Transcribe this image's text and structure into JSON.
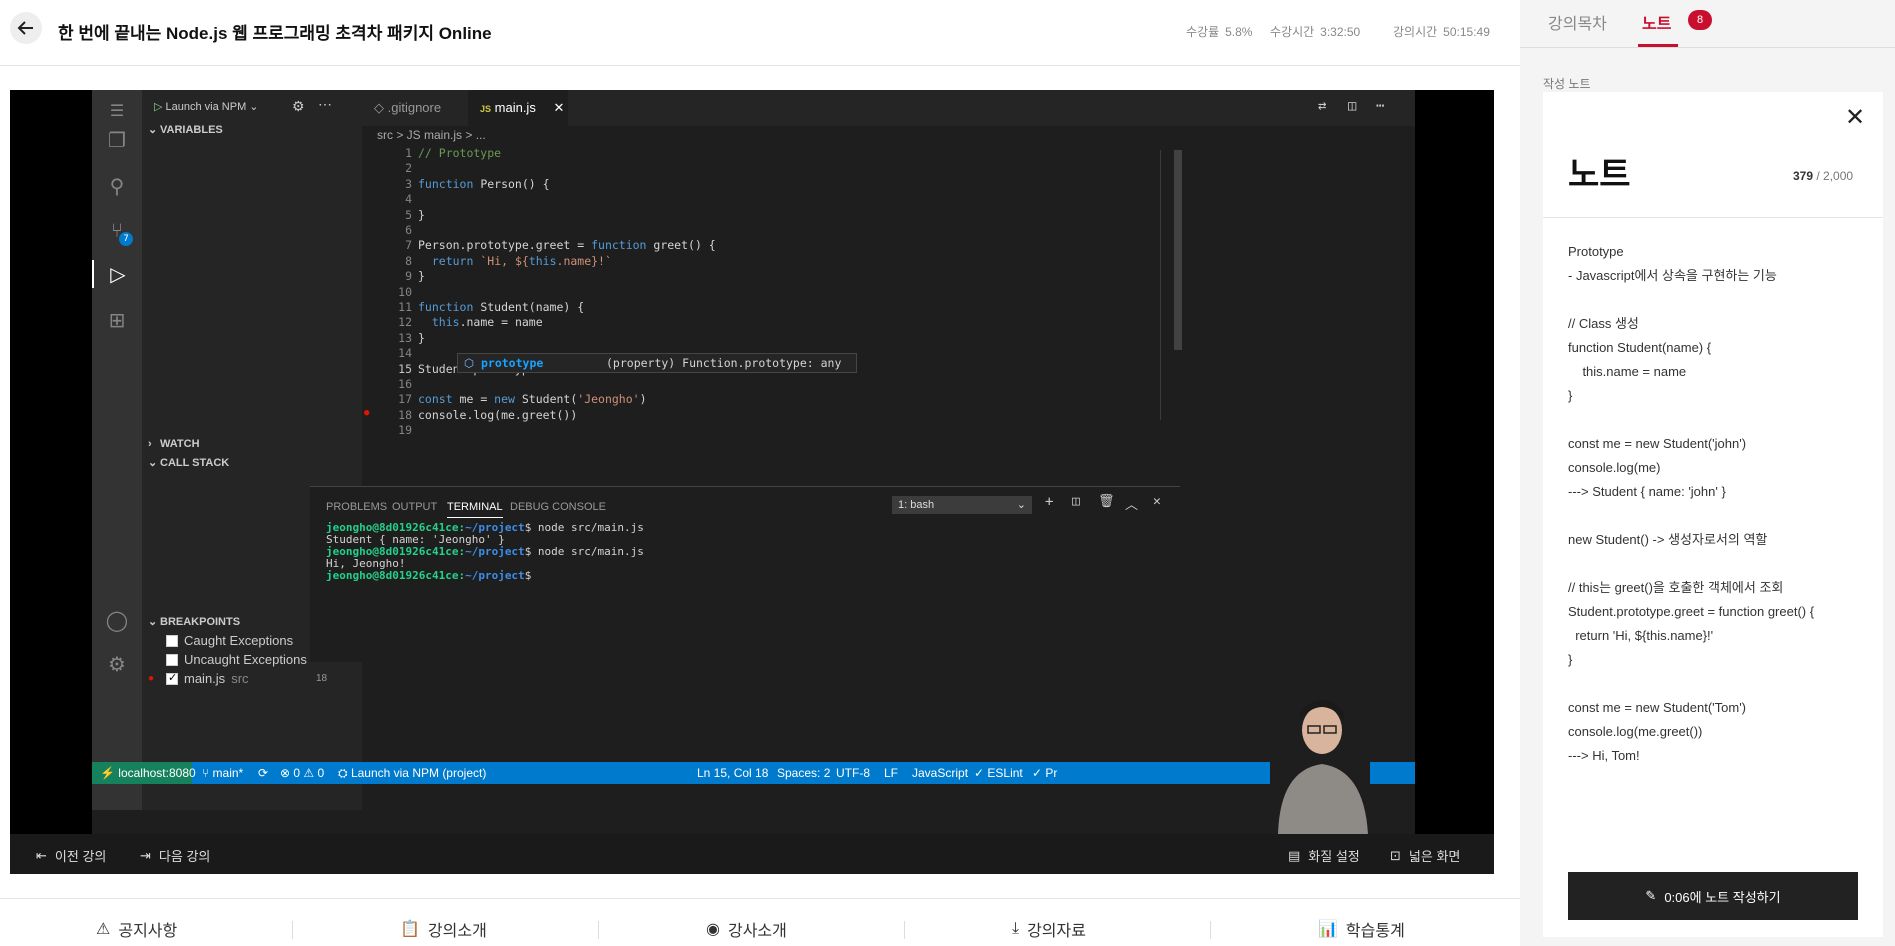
{
  "header": {
    "title": "한 번에 끝내는 Node.js 웹 프로그래밍 초격차 패키지 Online",
    "stats": [
      {
        "label": "수강률",
        "value": "5.8%"
      },
      {
        "label": "수강시간",
        "value": "3:32:50"
      },
      {
        "label": "강의시간",
        "value": "50:15:49"
      }
    ]
  },
  "vscode": {
    "debug_config": "Launch via NPM",
    "tabs": [
      ".gitignore",
      "main.js"
    ],
    "breadcrumb": "src  >  JS main.js  >  ...",
    "sections": {
      "variables": "VARIABLES",
      "watch": "WATCH",
      "call_stack": "CALL STACK",
      "breakpoints": "BREAKPOINTS"
    },
    "breakpoints": [
      {
        "label": "Caught Exceptions",
        "checked": false
      },
      {
        "label": "Uncaught Exceptions",
        "checked": false
      },
      {
        "label": "main.js",
        "sub": "src",
        "count": "18",
        "checked": true
      }
    ],
    "scm_badge": "7",
    "suggestion": {
      "name": "prototype",
      "detail": "(property) Function.prototype: any"
    },
    "panel_tabs": [
      "PROBLEMS",
      "OUTPUT",
      "TERMINAL",
      "DEBUG CONSOLE"
    ],
    "terminal_select": "1: bash",
    "terminal": [
      {
        "user": "jeongho@8d01926c41ce",
        "path": "~/project",
        "cmd": "$ node src/main.js"
      },
      {
        "text": "Student { name: 'Jeongho' }"
      },
      {
        "user": "jeongho@8d01926c41ce",
        "path": "~/project",
        "cmd": "$ node src/main.js"
      },
      {
        "text": "Hi, Jeongho!"
      },
      {
        "user": "jeongho@8d01926c41ce",
        "path": "~/project",
        "cmd": "$ "
      }
    ],
    "status": {
      "remote": "localhost:8080",
      "branch": "main*",
      "errors": "⊗ 0 ⚠ 0",
      "launch": "Launch via NPM (project)",
      "position": "Ln 15, Col 18",
      "spaces": "Spaces: 2",
      "encoding": "UTF-8",
      "eol": "LF",
      "language": "JavaScript",
      "eslint": "✓ ESLint",
      "prettier": "✓ Pr"
    }
  },
  "code_lines": [
    "// Prototype",
    "",
    "function Person() {",
    "",
    "}",
    "",
    "Person.prototype.greet = function greet() {",
    "  return `Hi, ${this.name}!`",
    "}",
    "",
    "function Student(name) {",
    "  this.name = name",
    "}",
    "",
    "Student.prototype",
    "",
    "const me = new Student('Jeongho')",
    "console.log(me.greet())",
    ""
  ],
  "video_controls": {
    "prev": "이전 강의",
    "next": "다음 강의",
    "quality": "화질 설정",
    "wide": "넓은 화면"
  },
  "bottom_nav": [
    "공지사항",
    "강의소개",
    "강사소개",
    "강의자료",
    "학습통계"
  ],
  "right": {
    "tabs": [
      "강의목차",
      "노트"
    ],
    "note_badge": "8",
    "write_label": "작성 노트",
    "note_title": "노트",
    "count_current": "379",
    "count_max": "/ 2,000",
    "note_body": "Prototype\n- Javascript에서 상속을 구현하는 기능\n\n// Class 생성\nfunction Student(name) {\n    this.name = name\n}\n\nconst me = new Student('john')\nconsole.log(me)\n---> Student { name: 'john' }\n\nnew Student() -> 생성자로서의 역할\n\n// this는 greet()을 호출한 객체에서 조회\nStudent.prototype.greet = function greet() {\n  return 'Hi, ${this.name}!'\n}\n\nconst me = new Student('Tom')\nconsole.log(me.greet())\n---> Hi, Tom!",
    "write_button": "0:06에 노트 작성하기"
  }
}
